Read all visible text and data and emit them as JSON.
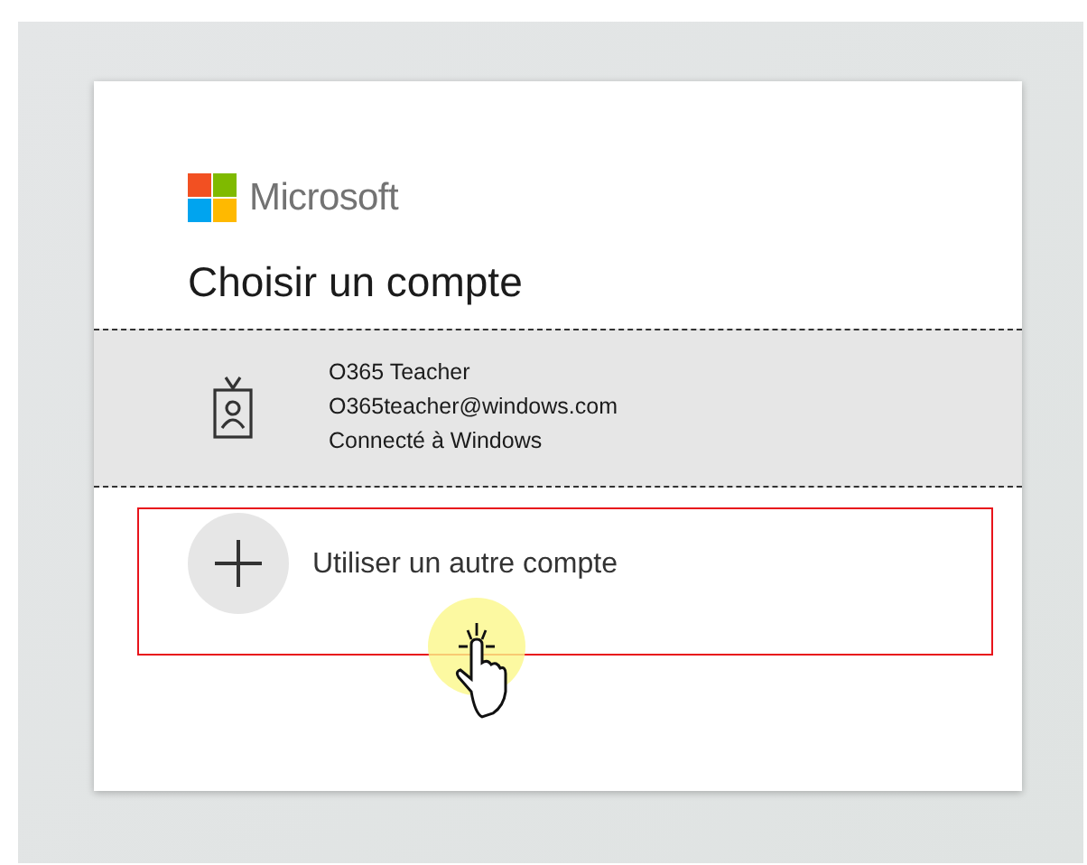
{
  "brand": "Microsoft",
  "title": "Choisir un compte",
  "accounts": [
    {
      "name": "O365 Teacher",
      "email": "O365teacher@windows.com",
      "status": "Connecté à Windows",
      "selected": true
    }
  ],
  "other_account": {
    "label": "Utiliser un autre compte",
    "highlighted": true
  }
}
